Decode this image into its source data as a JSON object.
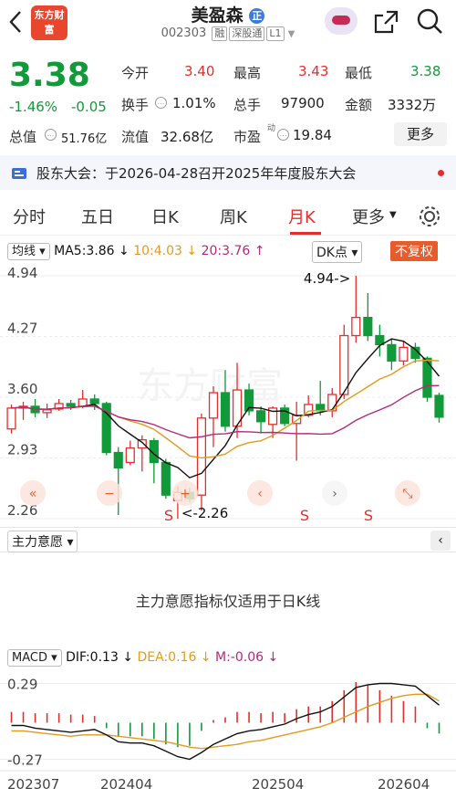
{
  "header": {
    "stock_name": "美盈森",
    "code": "002303",
    "tags": [
      "融",
      "深股通",
      "L1"
    ],
    "logo_text": "东方财富"
  },
  "quote": {
    "price": "3.38",
    "change_pct": "-1.46%",
    "change": "-0.05",
    "open_label": "今开",
    "open": "3.40",
    "high_label": "最高",
    "high": "3.43",
    "low_label": "最低",
    "low": "3.38",
    "turnover_label": "换手",
    "turnover": "1.01%",
    "volume_label": "总手",
    "volume": "97900",
    "amount_label": "金额",
    "amount": "3332万",
    "mcap_label": "总值",
    "mcap": "51.76亿",
    "float_label": "流值",
    "float": "32.68亿",
    "pe_label": "市盈",
    "pe_sup": "动",
    "pe": "19.84",
    "more_button": "更多"
  },
  "notice": {
    "text": "股东大会：于2026-04-28召开2025年年度股东大会"
  },
  "tabs": [
    "分时",
    "五日",
    "日K",
    "周K",
    "月K",
    "更多"
  ],
  "chart": {
    "indicator": "均线",
    "ma5": "MA5:3.86 ↓",
    "ma10": "10:4.03 ↓",
    "ma20": "20:3.76 ↑",
    "dk_label": "DK点",
    "restore_label": "不复权",
    "y_ticks": [
      "4.94",
      "4.27",
      "3.60",
      "2.93",
      "2.26"
    ],
    "high_annotation": "4.94->",
    "low_annotation": "<-2.26",
    "signal_labels": [
      "S",
      "S",
      "S"
    ],
    "colors": {
      "up": "#e0302b",
      "down": "#119a3a",
      "ma5": "#111111",
      "ma10": "#e39a1e",
      "ma20": "#b5287a"
    }
  },
  "chart_data": {
    "type": "candlestick",
    "series": [
      {
        "name": "K",
        "values": [
          {
            "o": 3.25,
            "c": 3.48,
            "h": 3.52,
            "l": 3.2
          },
          {
            "o": 3.48,
            "c": 3.5,
            "h": 3.55,
            "l": 3.35
          },
          {
            "o": 3.5,
            "c": 3.43,
            "h": 3.58,
            "l": 3.38
          },
          {
            "o": 3.43,
            "c": 3.46,
            "h": 3.53,
            "l": 3.37
          },
          {
            "o": 3.47,
            "c": 3.53,
            "h": 3.58,
            "l": 3.45
          },
          {
            "o": 3.53,
            "c": 3.5,
            "h": 3.57,
            "l": 3.46
          },
          {
            "o": 3.5,
            "c": 3.58,
            "h": 3.68,
            "l": 3.48
          },
          {
            "o": 3.58,
            "c": 3.53,
            "h": 3.63,
            "l": 3.46
          },
          {
            "o": 3.53,
            "c": 2.99,
            "h": 3.55,
            "l": 2.96
          },
          {
            "o": 2.99,
            "c": 2.82,
            "h": 3.05,
            "l": 2.3
          },
          {
            "o": 2.88,
            "c": 3.04,
            "h": 3.12,
            "l": 2.85
          },
          {
            "o": 3.04,
            "c": 3.13,
            "h": 3.18,
            "l": 2.78
          },
          {
            "o": 3.12,
            "c": 2.88,
            "h": 3.15,
            "l": 2.65
          },
          {
            "o": 2.88,
            "c": 2.52,
            "h": 2.92,
            "l": 2.48
          },
          {
            "o": 2.46,
            "c": 2.55,
            "h": 2.62,
            "l": 2.26
          },
          {
            "o": 2.55,
            "c": 2.48,
            "h": 2.6,
            "l": 2.44
          },
          {
            "o": 2.52,
            "c": 3.37,
            "h": 3.42,
            "l": 2.35
          },
          {
            "o": 3.37,
            "c": 3.65,
            "h": 3.72,
            "l": 3.05
          },
          {
            "o": 3.65,
            "c": 3.28,
            "h": 3.9,
            "l": 3.22
          },
          {
            "o": 3.28,
            "c": 3.68,
            "h": 3.98,
            "l": 3.15
          },
          {
            "o": 3.68,
            "c": 3.45,
            "h": 3.75,
            "l": 3.4
          },
          {
            "o": 3.45,
            "c": 3.33,
            "h": 3.5,
            "l": 3.2
          },
          {
            "o": 3.3,
            "c": 3.48,
            "h": 3.5,
            "l": 3.15
          },
          {
            "o": 3.48,
            "c": 3.31,
            "h": 3.52,
            "l": 3.28
          },
          {
            "o": 3.31,
            "c": 3.4,
            "h": 3.55,
            "l": 2.9
          },
          {
            "o": 3.4,
            "c": 3.52,
            "h": 3.62,
            "l": 3.38
          },
          {
            "o": 3.52,
            "c": 3.45,
            "h": 3.78,
            "l": 3.4
          },
          {
            "o": 3.45,
            "c": 3.63,
            "h": 3.7,
            "l": 3.38
          },
          {
            "o": 3.63,
            "c": 4.28,
            "h": 4.4,
            "l": 3.58
          },
          {
            "o": 4.28,
            "c": 4.48,
            "h": 4.94,
            "l": 4.2
          },
          {
            "o": 4.48,
            "c": 4.28,
            "h": 4.75,
            "l": 4.22
          },
          {
            "o": 4.28,
            "c": 4.18,
            "h": 4.4,
            "l": 4.05
          },
          {
            "o": 4.18,
            "c": 4.0,
            "h": 4.25,
            "l": 3.9
          },
          {
            "o": 4.0,
            "c": 4.15,
            "h": 4.22,
            "l": 3.95
          },
          {
            "o": 4.15,
            "c": 4.03,
            "h": 4.2,
            "l": 3.98
          },
          {
            "o": 4.03,
            "c": 3.6,
            "h": 4.05,
            "l": 3.55
          },
          {
            "o": 3.62,
            "c": 3.38,
            "h": 3.65,
            "l": 3.32
          }
        ]
      }
    ],
    "ylim": [
      2.26,
      4.94
    ],
    "y_ticks": [
      4.94,
      4.27,
      3.6,
      2.93,
      2.26
    ]
  },
  "zlyy": {
    "title": "主力意愿",
    "message": "主力意愿指标仅适用于日K线"
  },
  "macd": {
    "title": "MACD",
    "dif": "DIF:0.13 ↓",
    "dea": "DEA:0.16 ↓",
    "m": "M:-0.06 ↓",
    "y_ticks": [
      "0.29",
      "-0.27"
    ],
    "x_labels": [
      "202307",
      "202404",
      "202504",
      "202604"
    ],
    "hist": [
      0.08,
      0.08,
      0.07,
      0.07,
      0.07,
      0.06,
      0.06,
      0.05,
      -0.04,
      -0.1,
      -0.1,
      -0.1,
      -0.12,
      -0.16,
      -0.18,
      -0.17,
      -0.06,
      0.02,
      0.04,
      0.08,
      0.08,
      0.07,
      0.08,
      0.07,
      0.1,
      0.12,
      0.12,
      0.16,
      0.24,
      0.3,
      0.28,
      0.24,
      0.2,
      0.16,
      0.12,
      -0.04,
      -0.08
    ],
    "dif_line": [
      -0.02,
      -0.02,
      -0.04,
      -0.05,
      -0.06,
      -0.07,
      -0.06,
      -0.05,
      -0.09,
      -0.14,
      -0.15,
      -0.15,
      -0.17,
      -0.21,
      -0.25,
      -0.27,
      -0.22,
      -0.16,
      -0.12,
      -0.08,
      -0.06,
      -0.05,
      -0.03,
      -0.01,
      0.03,
      0.06,
      0.08,
      0.12,
      0.19,
      0.26,
      0.28,
      0.29,
      0.29,
      0.28,
      0.27,
      0.2,
      0.13
    ],
    "dea_line": [
      -0.06,
      -0.06,
      -0.07,
      -0.08,
      -0.09,
      -0.1,
      -0.09,
      -0.09,
      -0.09,
      -0.1,
      -0.11,
      -0.12,
      -0.13,
      -0.14,
      -0.16,
      -0.18,
      -0.19,
      -0.18,
      -0.17,
      -0.16,
      -0.14,
      -0.13,
      -0.11,
      -0.09,
      -0.07,
      -0.05,
      -0.03,
      0.0,
      0.04,
      0.08,
      0.12,
      0.15,
      0.18,
      0.2,
      0.21,
      0.21,
      0.16
    ]
  }
}
